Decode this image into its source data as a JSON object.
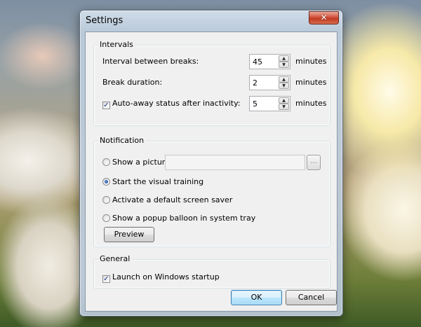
{
  "window": {
    "title": "Settings",
    "close_glyph": "✕"
  },
  "intervals": {
    "legend": "Intervals",
    "interval_label": "Interval between breaks:",
    "interval_value": "45",
    "interval_unit": "minutes",
    "break_label": "Break duration:",
    "break_value": "2",
    "break_unit": "minutes",
    "autoaway_label": "Auto-away status after inactivity:",
    "autoaway_checked": true,
    "autoaway_value": "5",
    "autoaway_unit": "minutes"
  },
  "notification": {
    "legend": "Notification",
    "picture_label": "Show a picture:",
    "picture_path": "",
    "browse_label": "...",
    "visual_label": "Start the visual training",
    "screensaver_label": "Activate a default screen saver",
    "balloon_label": "Show a popup balloon in system tray",
    "selected": "visual",
    "preview_label": "Preview"
  },
  "general": {
    "legend": "General",
    "startup_label": "Launch on Windows startup",
    "startup_checked": true
  },
  "buttons": {
    "ok_label": "OK",
    "cancel_label": "Cancel"
  },
  "icons": {
    "spin_up": "▲",
    "spin_down": "▼",
    "check": "✓"
  },
  "colors": {
    "default_button_border": "#3c7fb1",
    "close_button": "#c23a22",
    "radio_dot": "#1a3e90"
  }
}
